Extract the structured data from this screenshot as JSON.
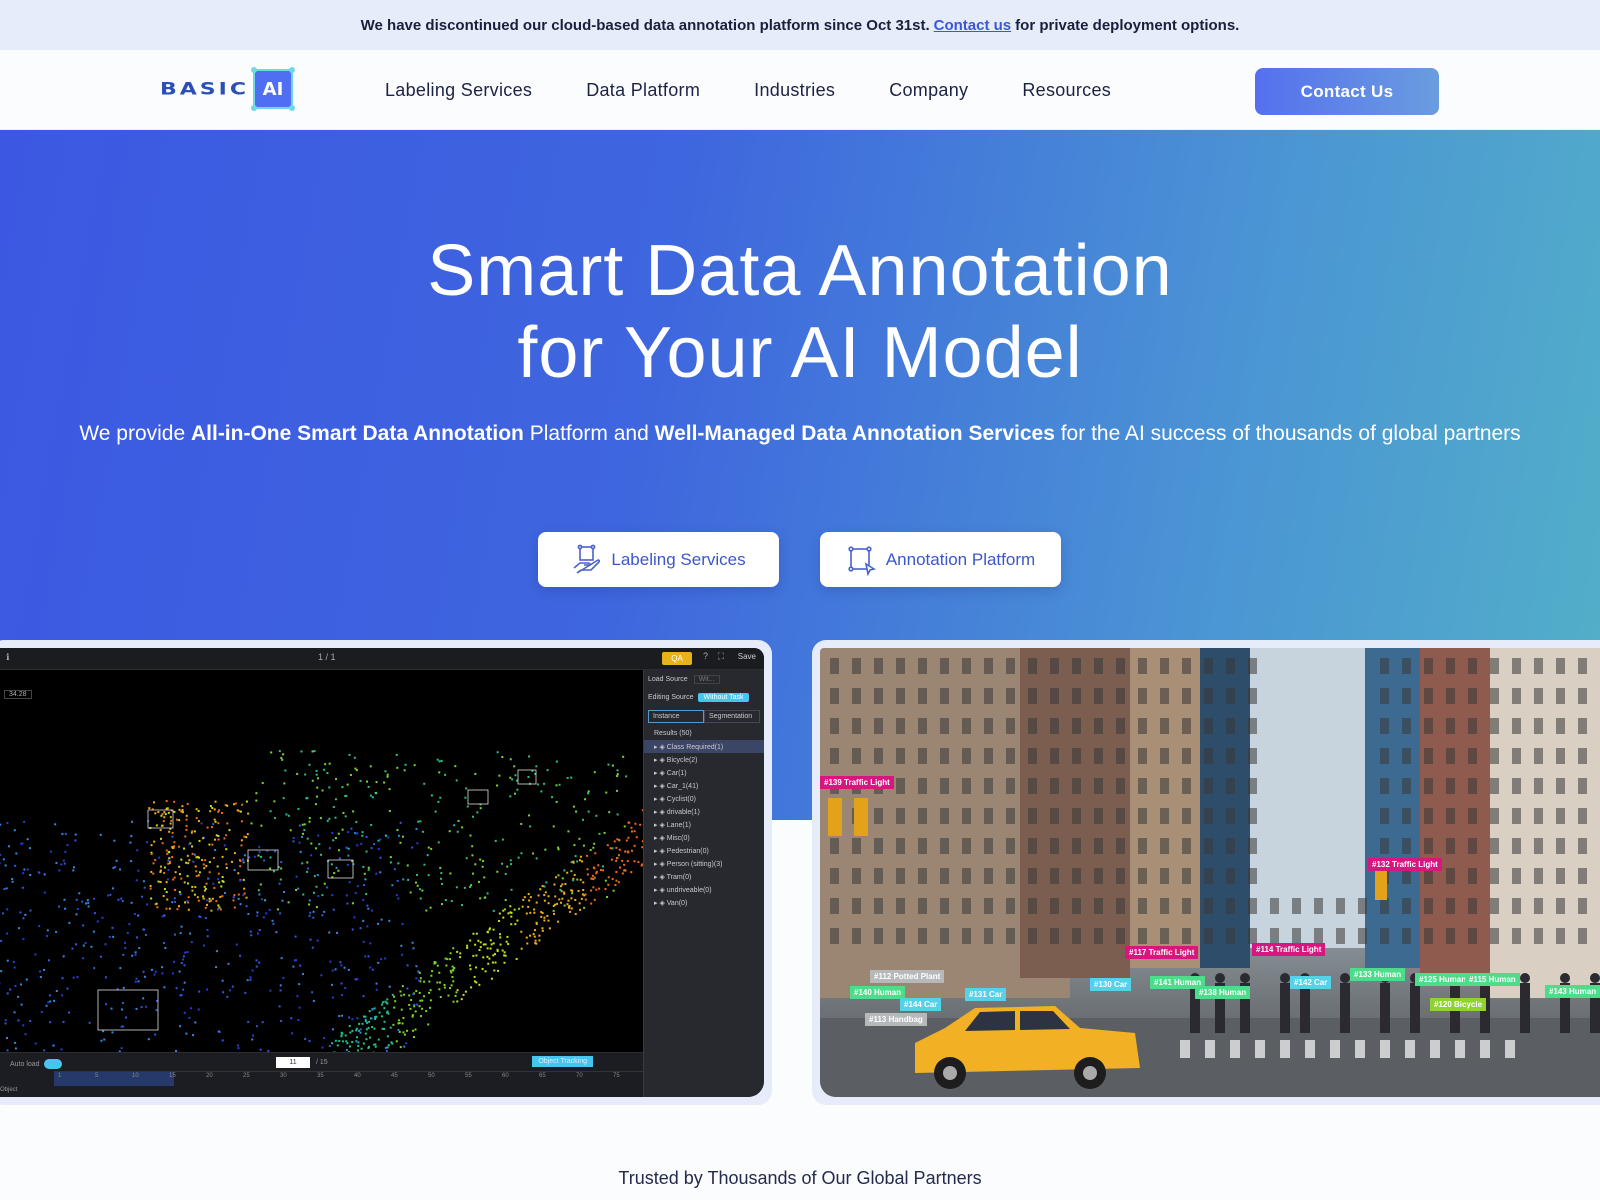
{
  "announcement": {
    "text_before": "We have discontinued our cloud-based data annotation platform since Oct 31st.",
    "link": "Contact us",
    "text_after": "for private deployment options."
  },
  "brand": {
    "wordmark": "BASIC",
    "badge": "AI"
  },
  "nav": {
    "items": [
      "Labeling Services",
      "Data Platform",
      "Industries",
      "Company",
      "Resources"
    ],
    "cta": "Contact Us"
  },
  "colors": {
    "hero_start": "#3c58e2",
    "hero_end": "#52b0c8",
    "accent": "#3b57c9",
    "tag_pink": "#d5177f",
    "tag_green": "#4ddc8a"
  },
  "hero": {
    "title_line1": "Smart Data Annotation",
    "title_line2": "for Your AI Model",
    "sub": {
      "p1": "We provide ",
      "b1": "All-in-One Smart Data Annotation",
      "p2": " Platform and ",
      "b2": "Well-Managed Data Annotation Services",
      "p3": " for the AI success of thousands of global partners"
    },
    "buttons": [
      {
        "label": "Labeling Services",
        "icon": "hand-box-icon"
      },
      {
        "label": "Annotation Platform",
        "icon": "box-cursor-icon"
      }
    ]
  },
  "lidar_tool": {
    "pager": "1 / 1",
    "qa_label": "QA",
    "save_label": "Save",
    "load_source_label": "Load Source",
    "load_source_value": "Wit...",
    "editing_source_label": "Editing Source",
    "editing_source_value": "Without Task",
    "tabs": [
      "Instance",
      "Segmentation"
    ],
    "results_label": "Results (50)",
    "classes": [
      "Class Required(1)",
      "Bicycle(2)",
      "Car(1)",
      "Car_1(41)",
      "Cyclist(0)",
      "drivable(1)",
      "Lane(1)",
      "Misc(0)",
      "Pedestrian(0)",
      "Person (sitting)(3)",
      "Tram(0)",
      "undriveable(0)",
      "Van(0)"
    ],
    "range_value": "34.28",
    "auto_load_label": "Auto load",
    "frame_current": "11",
    "frame_total": "/ 15",
    "object_tracking_label": "Object Tracking",
    "timeline_ticks": [
      "1",
      "5",
      "10",
      "15",
      "20",
      "25",
      "30",
      "35",
      "40",
      "45",
      "50",
      "55",
      "60",
      "65",
      "70",
      "75"
    ],
    "row_label": "Object"
  },
  "street_tags": [
    {
      "text": "#139 Traffic Light",
      "color": "pink"
    },
    {
      "text": "#117 Traffic Light",
      "color": "pink"
    },
    {
      "text": "#114 Traffic Light",
      "color": "pink"
    },
    {
      "text": "#132 Traffic Light",
      "color": "pink"
    },
    {
      "text": "#112 Potted Plant",
      "color": "grey"
    },
    {
      "text": "#140 Human",
      "color": "green"
    },
    {
      "text": "#144 Car",
      "color": "cyan"
    },
    {
      "text": "#113 Handbag",
      "color": "grey"
    },
    {
      "text": "#131 Car",
      "color": "cyan"
    },
    {
      "text": "#130 Car",
      "color": "cyan"
    },
    {
      "text": "#141 Human",
      "color": "green"
    },
    {
      "text": "#138 Human",
      "color": "green"
    },
    {
      "text": "#142 Car",
      "color": "cyan"
    },
    {
      "text": "#133 Human",
      "color": "green"
    },
    {
      "text": "#125 Human",
      "color": "green"
    },
    {
      "text": "#115 Human",
      "color": "green"
    },
    {
      "text": "#120 Bicycle",
      "color": "lime"
    },
    {
      "text": "#143 Human",
      "color": "green"
    }
  ],
  "partners_heading": "Trusted by Thousands of Our Global Partners"
}
